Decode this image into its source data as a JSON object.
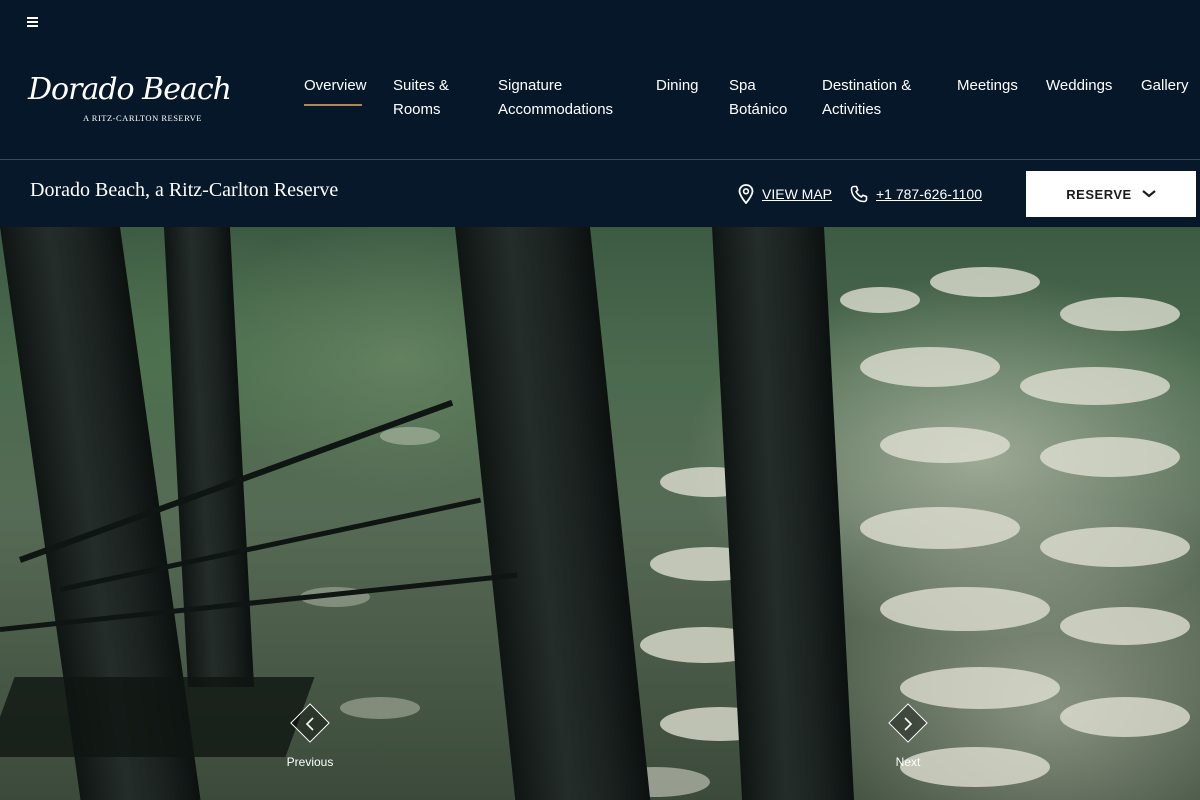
{
  "header": {
    "logo": {
      "title": "Dorado Beach",
      "subtitle": "A RITZ-CARLTON RESERVE"
    },
    "nav": [
      {
        "label": "Overview",
        "active": true
      },
      {
        "label": "Suites & Rooms"
      },
      {
        "label": "Signature Accommodations"
      },
      {
        "label": "Dining"
      },
      {
        "label": "Spa Botánico"
      },
      {
        "label": "Destination & Activities"
      },
      {
        "label": "Meetings"
      },
      {
        "label": "Weddings"
      },
      {
        "label": "Gallery"
      }
    ],
    "accent_color": "#a9895a"
  },
  "subbar": {
    "property_name": "Dorado Beach, a Ritz-Carlton Reserve",
    "map_label": "VIEW MAP",
    "phone": "+1 787-626-1100",
    "reserve_label": "RESERVE"
  },
  "hero": {
    "previous_label": "Previous",
    "next_label": "Next"
  },
  "icons": {
    "menu": "menu-icon",
    "map": "location-pin-icon",
    "phone": "phone-icon",
    "reserve": "chevron-down-icon",
    "previous": "chevron-left-icon",
    "next": "chevron-right-icon"
  }
}
